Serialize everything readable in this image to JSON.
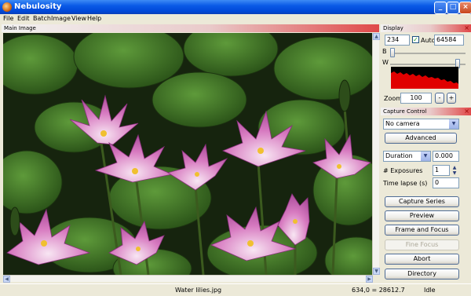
{
  "window": {
    "title": "Nebulosity"
  },
  "menu": [
    "File",
    "Edit",
    "Batch",
    "Image",
    "View",
    "Help"
  ],
  "main_image": {
    "title": "Main Image"
  },
  "display": {
    "title": "Display",
    "black_value": "234",
    "auto_label": "Auto",
    "auto_checked": true,
    "white_value": "64584",
    "b_label": "B",
    "w_label": "W",
    "zoom_label": "Zoom",
    "zoom_value": "100",
    "zoom_minus": "-",
    "zoom_plus": "+"
  },
  "capture": {
    "title": "Capture Control",
    "camera_selected": "No camera",
    "advanced_label": "Advanced",
    "duration_label": "Duration",
    "duration_value": "0.000",
    "exposures_label": "# Exposures",
    "exposures_value": "1",
    "timelapse_label": "Time lapse (s)",
    "timelapse_value": "0",
    "capture_series_label": "Capture Series",
    "preview_label": "Preview",
    "frame_focus_label": "Frame and Focus",
    "fine_focus_label": "Fine Focus",
    "abort_label": "Abort",
    "directory_label": "Directory"
  },
  "status": {
    "filename": "Water lilies.jpg",
    "coords": "634,0 = 28612.7",
    "state": "Idle"
  },
  "colors": {
    "histogram": "#E00000",
    "title_bar": "#0A5AE6",
    "panel_header": "#E04848"
  }
}
